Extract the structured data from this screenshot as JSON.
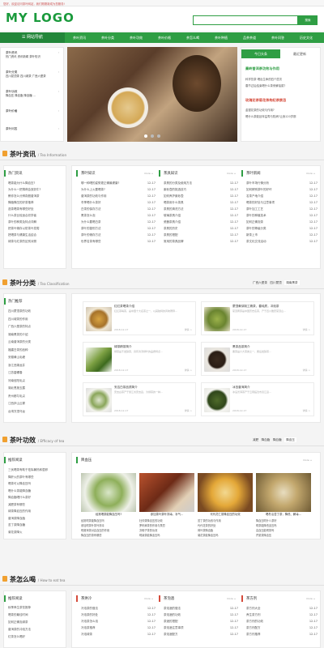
{
  "topbar": {
    "text": "您好，欢迎访问茶叶网站，我们刚刚新成为您服务!"
  },
  "header": {
    "logo": "MY LOGO",
    "search_button": "搜索"
  },
  "nav": {
    "home": "网站导航",
    "items": [
      "茶叶资讯",
      "茶叶分类",
      "茶叶功效",
      "茶叶价格",
      "茶怎么喝",
      "茶叶种植",
      "品茶茶道",
      "茶叶问答",
      "历史文化"
    ]
  },
  "sidebar": [
    {
      "title": "茶叶资讯",
      "line2": "热门资讯 资讯新闻 茶叶知识"
    },
    {
      "title": "茶叶分类",
      "line2": "四川蒙顶茶 四川城茶 广西六堡茶"
    },
    {
      "title": "茶叶功效",
      "line2": "降血压 降血脂 降血糖 ..."
    },
    {
      "title": "茶叶价格",
      "line2": ""
    },
    {
      "title": "茶叶问答",
      "line2": ""
    }
  ],
  "news_box": {
    "tabs": [
      "今日头条",
      "最近更新"
    ],
    "hl1": "秦岭普洱茶功效与作用",
    "items1": [
      "科学饮茶 喝出生命的四个层次",
      "春节过后结束喝什么茶来解油腻?"
    ],
    "hl2": "玫瑰花茶菊花茶枸杞茶禁忌",
    "items2": [
      "金银花茶的功效与作用?",
      "喝什么茶能延年益寿与防病?让我120岁那"
    ]
  },
  "sec_news": {
    "title": "茶叶资讯",
    "en": "/ Tea Information",
    "hot_title": "热门资讯",
    "hot": [
      "喝茶能为什么降血压?",
      "为什么一把薄荷会放奶牛?",
      "教你怎么分辨真假普洱茶",
      "降脂降压的好茶推荐",
      "选茶喝茶有哪些好处",
      "什么茶比较适合初学者",
      "茶叶的种类及特点详解",
      "把茶叶储存以防茶叶发霉",
      "把喝茶与健康生活结合",
      "绿茶与红茶的区别对照"
    ],
    "cols": [
      {
        "title": "茶叶知识",
        "more": "more +",
        "items": [
          "哪一种喝的姿势更正确最健康?",
          "为什么上火要喝茶?",
          "普洱茶的功效与作用",
          "冬季喝什么茶好",
          "白茶的保存方法",
          "黑茶怎么泡",
          "为什么要喝白茶",
          "茶叶的鉴别方法",
          "茶叶的储存方法",
          "世界名茶有哪些"
        ],
        "dates": [
          "12-17",
          "12-17",
          "12-17",
          "12-17",
          "12-17",
          "12-17",
          "12-17",
          "12-17",
          "12-17",
          "12-17"
        ]
      },
      {
        "title": "茶具知识",
        "more": "more +",
        "items": [
          "茶具的分类及使用方法",
          "紫砂壶的挑选技巧",
          "如何养护紫砂壶",
          "喝茶用什么茶具",
          "茶具的清洗方法",
          "玻璃茶具介绍",
          "瓷器茶具介绍",
          "茶具的历史",
          "茶具的搭配",
          "常用的茶具品牌"
        ],
        "dates": [
          "12-17",
          "12-17",
          "12-17",
          "12-17",
          "12-17",
          "12-17",
          "12-17",
          "12-17",
          "12-17",
          "12-17"
        ]
      },
      {
        "title": "茶叶新闻",
        "more": "more +",
        "items": [
          "茶叶市场行情分析",
          "如何辨别茶叶的好坏",
          "名茶产地介绍",
          "喝茶的好处与注意事项",
          "茶叶加工工艺",
          "茶叶的种植技术",
          "如何正确泡茶",
          "茶叶的等级分类",
          "新茶上市",
          "茶文化交流活动"
        ],
        "dates": [
          "12-17",
          "12-17",
          "12-17",
          "12-17",
          "12-17",
          "12-17",
          "12-17",
          "12-17",
          "12-17",
          "12-17"
        ]
      }
    ]
  },
  "sec_class": {
    "title": "茶叶分类",
    "en": "/ Tea Classification",
    "tabs": [
      "广西六堡茶",
      "四川蒙顶",
      "湖南黑茶"
    ],
    "hot_title": "热门推荐",
    "hot": [
      "四川蒙顶茶的功效",
      "四川城茶的作用",
      "广西六堡茶的特点",
      "湖南黑茶的介绍",
      "云南普洱茶的分类",
      "福建白茶的品种",
      "安徽黄山毛峰",
      "浙江西湖龙井",
      "江苏碧螺春",
      "河南信阳毛尖",
      "湖北恩施玉露",
      "贵州都匀毛尖",
      "江西庐山云雾",
      "台湾冻顶乌龙"
    ],
    "cards": [
      {
        "title": "红红茶喝茶介绍",
        "desc": "红红茶喝茶，是中国十大名茶之一，以其独特的风味著称...",
        "date": "2018-12-17",
        "more": "详情 >"
      },
      {
        "title": "蒙顶黄芽制工精茶，春纯质，冲泡茶",
        "desc": "蒙顶黄芽是中国历史名茶，产于四川雅安蒙顶山...",
        "date": "2018-12-17",
        "more": "详情 >"
      },
      {
        "title": "绿茶精茶简介",
        "desc": "绿茶是不发酵茶，具有清汤绿叶的品质特点...",
        "date": "2018-12-17",
        "more": "详情 >"
      },
      {
        "title": "黑茶品茶简介",
        "desc": "黑茶是六大茶类之一，属后发酵茶...",
        "date": "2018-12-17",
        "more": "详情 >"
      },
      {
        "title": "安吉白茶品质简介",
        "desc": "安吉白茶产于浙江省安吉县，为绿茶的一种...",
        "date": "2018-12-17",
        "more": "详情 >"
      },
      {
        "title": "冰岛普洱简介",
        "desc": "冰岛普洱茶产于云南临沧市双江县...",
        "date": "2018-12-17",
        "more": "详情 >"
      }
    ]
  },
  "sec_effect": {
    "title": "茶叶功效",
    "en": "/ Efficacy of tea",
    "tabs": [
      "减肥",
      "降血脂",
      "降血糖",
      "降血压"
    ],
    "hot_title": "推荐阅读",
    "hot": [
      "三伏喝茶有助于祛除暑热和湿邪",
      "降肝火的茶叶有哪些",
      "喝茶可以降血压吗",
      "喝什么茶能降血糖",
      "降血脂喝什么茶好",
      "减肥茶有哪些",
      "绿茶降血压的作用",
      "普洱茶降血脂",
      "苦丁茶降血糖",
      "菊花茶降火"
    ],
    "panel_title": "降血压",
    "panel_more": "more +",
    "images": [
      {
        "label": "经常喝茶能降血压吗?"
      },
      {
        "label": "参加茶叶茶叶排毒，补气..."
      },
      {
        "label": "代代花仁茶降血压的功效"
      },
      {
        "label": "喝冬瓜苦丁茶，降低、解毒..."
      }
    ],
    "list1": [
      "经常喝茶能降血压吗",
      "参加喝茶叶茶叶排毒",
      "喝普洱茶对高血压的作用",
      "降血压的茶有哪些",
      "喝茶降血压的注意事项"
    ],
    "list2": [
      "杜仲茶降血压的功效",
      "罗布麻茶的作用与禁忌",
      "决明子茶的功效",
      "喝绿茶能降血压吗",
      "山楂茶的作用"
    ],
    "list3": [
      "苦丁茶的功效与作用",
      "代代花茶的好处",
      "荷叶茶降血脂",
      "菊花茶能降血压吗",
      "玉米须茶的作用"
    ],
    "list4": [
      "降血压喝什么茶好",
      "喝茶能降低血压吗",
      "高血压能喝茶吗",
      "芹菜茶降血压",
      "决明子降压茶"
    ]
  },
  "sec_drink": {
    "title": "茶怎么喝",
    "en": "/ How to eat tea",
    "hot_title": "推荐阅读",
    "hot": [
      "秋季养生茶饮推荐",
      "喝茶的最佳时间",
      "如何正确泡绿茶",
      "普洱茶的冲泡方法",
      "红茶怎么喝好"
    ],
    "cols": [
      {
        "title": "茶烘冷",
        "more": "more +",
        "items": [
          "冷泡茶的做法",
          "冷泡茶的好处",
          "冷泡茶怎么泡",
          "冷泡茶推荐",
          "冷泡绿茶"
        ],
        "dates": [
          "12-17",
          "12-17",
          "12-17",
          "12-17",
          "12-17"
        ]
      },
      {
        "title": "茶泡酒",
        "more": "more +",
        "items": [
          "茶泡酒的做法",
          "茶泡酒的功效",
          "茶酒的搭配",
          "茶泡酒注意事项",
          "茶泡酒配方"
        ],
        "dates": [
          "12-17",
          "12-17",
          "12-17",
          "12-17",
          "12-17"
        ]
      },
      {
        "title": "茶方剂",
        "more": "more +",
        "items": [
          "茶方剂大全",
          "养生茶方剂",
          "茶方剂的功效",
          "茶方剂配方",
          "茶方剂推荐"
        ],
        "dates": [
          "12-17",
          "12-17",
          "12-17",
          "12-17",
          "12-17"
        ]
      }
    ]
  },
  "colors": {
    "green": "#2f9e44",
    "dark_green": "#23863a",
    "red": "#d54b3b"
  }
}
